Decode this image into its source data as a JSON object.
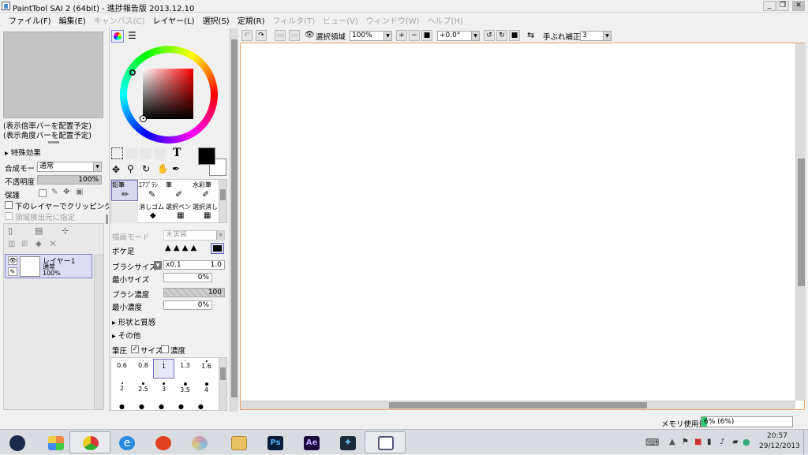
{
  "title_bar": {
    "title": "PaintTool SAI 2 (64bit) - 進捗報告版 2013.12.10",
    "minimize": "_",
    "restore": "❐",
    "close": "✕"
  },
  "menu": [
    {
      "label": "ファイル(F)",
      "enabled": true
    },
    {
      "label": "編集(E)",
      "enabled": true
    },
    {
      "label": "キャンバス(C)",
      "enabled": false
    },
    {
      "label": "レイヤー(L)",
      "enabled": true
    },
    {
      "label": "選択(S)",
      "enabled": true
    },
    {
      "label": "定規(R)",
      "enabled": true
    },
    {
      "label": "フィルタ(T)",
      "enabled": false
    },
    {
      "label": "ビュー(V)",
      "enabled": false
    },
    {
      "label": "ウィンドウ(W)",
      "enabled": false
    },
    {
      "label": "ヘルプ(H)",
      "enabled": false
    }
  ],
  "left": {
    "zoom_placeholder": "(表示倍率バーを配置予定)",
    "angle_placeholder": "(表示角度バーを配置予定)",
    "effects_header": "特殊効果",
    "blend_mode_label": "合成モード",
    "blend_mode_value": "通常",
    "opacity_label": "不透明度",
    "opacity_value": "100%",
    "protect_label": "保護",
    "clip_label": "下のレイヤーでクリッピング",
    "selection_source_label": "領域検出元に指定"
  },
  "layer": {
    "name": "レイヤー1",
    "mode": "通常",
    "opacity": "100%"
  },
  "tools": {
    "text_tool": "T",
    "brushes": [
      {
        "name": "鉛筆",
        "selected": true
      },
      {
        "name": "ｴｱﾌﾞﾗｼ",
        "selected": false
      },
      {
        "name": "筆",
        "selected": false
      },
      {
        "name": "水彩筆",
        "selected": false
      },
      {
        "name": "",
        "selected": false
      },
      {
        "name": "消しゴム",
        "selected": false
      },
      {
        "name": "選択ペン",
        "selected": false
      },
      {
        "name": "選択消し",
        "selected": false
      }
    ]
  },
  "brush_settings": {
    "draw_mode_label": "描画モード",
    "draw_mode_value": "未実装",
    "bokeh_label": "ボケ足",
    "brush_size_label": "ブラシサイズ",
    "brush_size_mult": "x0.1",
    "brush_size_value": "1.0",
    "min_size_label": "最小サイズ",
    "min_size_value": "0%",
    "density_label": "ブラシ濃度",
    "density_value": "100",
    "min_density_label": "最小濃度",
    "min_density_value": "0%",
    "shape_header": "形状と質感",
    "other_header": "その他",
    "pressure_label": "筆圧",
    "pressure_size_label": "サイズ",
    "pressure_density_label": "濃度",
    "sizes": [
      {
        "label": "0.6",
        "selected": false
      },
      {
        "label": "0.8",
        "selected": false
      },
      {
        "label": "1",
        "selected": true
      },
      {
        "label": "1.3",
        "selected": false
      },
      {
        "label": "1.6",
        "selected": false
      },
      {
        "label": "2",
        "selected": false
      },
      {
        "label": "2.5",
        "selected": false
      },
      {
        "label": "3",
        "selected": false
      },
      {
        "label": "3.5",
        "selected": false
      },
      {
        "label": "4",
        "selected": false
      }
    ]
  },
  "canvas_toolbar": {
    "selection_label": "選択領域",
    "zoom_value": "100%",
    "angle_value": "+0.0°",
    "stabilizer_label": "手ぶれ補正",
    "stabilizer_value": "3"
  },
  "status": {
    "memory_label": "メモリ使用量",
    "memory_value": "6% (6%)",
    "memory_fraction": 0.06
  },
  "taskbar": {
    "apps": [
      {
        "name": "windows-start",
        "active": false
      },
      {
        "name": "metro",
        "active": false
      },
      {
        "name": "chrome",
        "active": true
      },
      {
        "name": "ie",
        "active": false
      },
      {
        "name": "app-red",
        "active": false
      },
      {
        "name": "paint",
        "active": false
      },
      {
        "name": "explorer",
        "active": false
      },
      {
        "name": "photoshop",
        "label": "Ps",
        "active": false
      },
      {
        "name": "after-effects",
        "label": "Ae",
        "active": false
      },
      {
        "name": "butterfly",
        "active": false
      },
      {
        "name": "sai",
        "active": true
      }
    ],
    "time": "20:57",
    "date": "29/12/2013"
  },
  "colors": {
    "primary": "#000000",
    "secondary": "#ffffff",
    "accent": "#4a8fd4"
  }
}
